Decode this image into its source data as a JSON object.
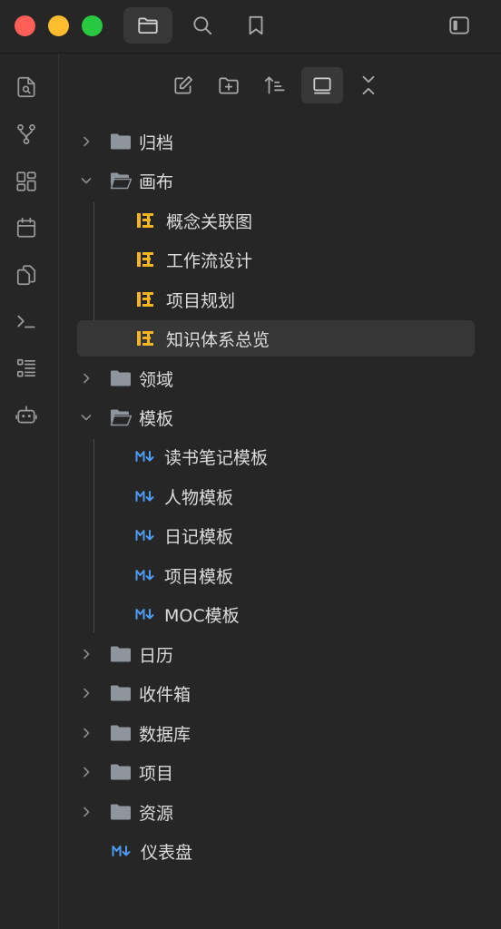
{
  "toolbar": {
    "icons": [
      "folder-icon",
      "search-icon",
      "bookmark-icon",
      "sidebar-toggle-icon"
    ]
  },
  "ribbon": {
    "icons": [
      "search-file-icon",
      "graph-icon",
      "layout-icon",
      "calendar-icon",
      "copy-icon",
      "terminal-icon",
      "list-icon",
      "bot-icon"
    ]
  },
  "nav": {
    "icons": [
      "new-note-icon",
      "new-folder-icon",
      "sort-icon",
      "collapse-all-icon",
      "expand-icon"
    ]
  },
  "tree": {
    "archive": "归档",
    "canvas": "画布",
    "canvas_files": [
      "概念关联图",
      "工作流设计",
      "项目规划",
      "知识体系总览"
    ],
    "domain": "领域",
    "templates": "模板",
    "template_files": [
      "读书笔记模板",
      "人物模板",
      "日记模板",
      "项目模板",
      "MOC模板"
    ],
    "calendar": "日历",
    "inbox": "收件箱",
    "database": "数据库",
    "projects": "项目",
    "resources": "资源",
    "dashboard": "仪表盘"
  },
  "colors": {
    "canvas_icon": "#f2b51d",
    "md_icon": "#4c9bf2",
    "folder": "#8e959c"
  }
}
